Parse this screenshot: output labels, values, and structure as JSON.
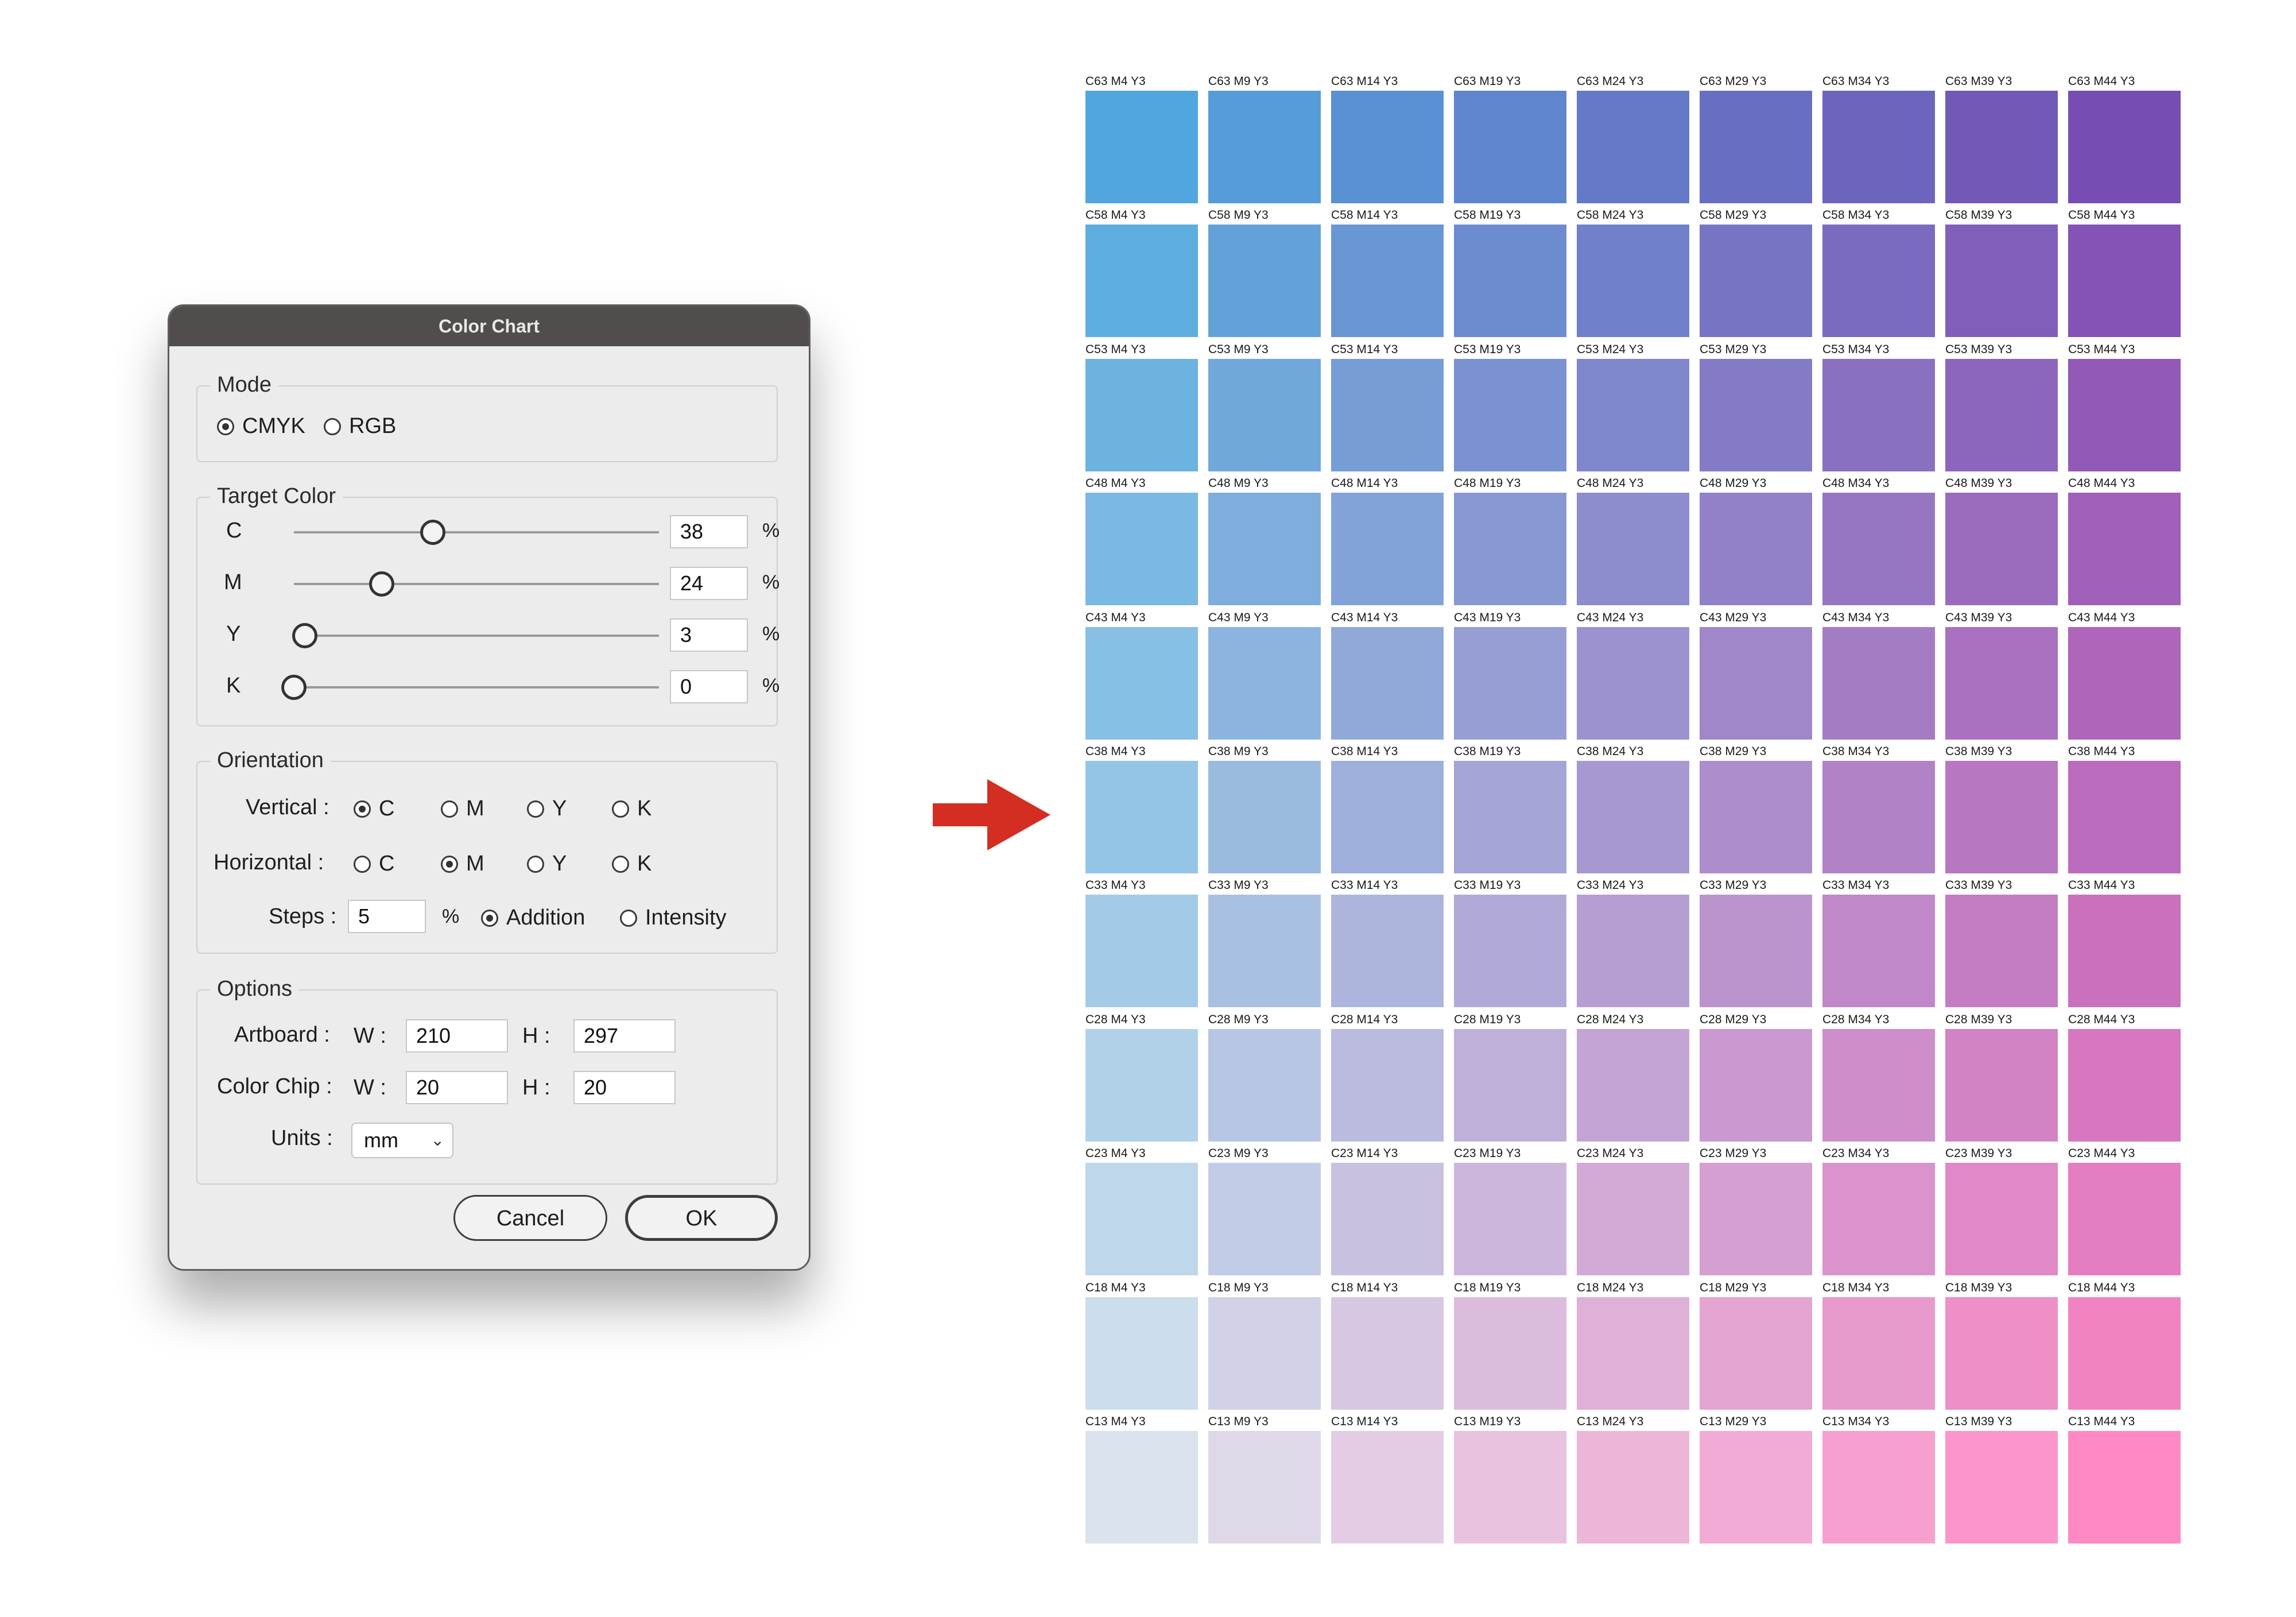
{
  "dialog": {
    "title": "Color Chart",
    "mode": {
      "legend": "Mode",
      "options": [
        "CMYK",
        "RGB"
      ],
      "selected": "CMYK"
    },
    "target": {
      "legend": "Target Color",
      "channels": [
        {
          "label": "C",
          "value": "38",
          "fraction": 0.38
        },
        {
          "label": "M",
          "value": "24",
          "fraction": 0.24
        },
        {
          "label": "Y",
          "value": "3",
          "fraction": 0.03
        },
        {
          "label": "K",
          "value": "0",
          "fraction": 0.0
        }
      ],
      "unit": "%"
    },
    "orientation": {
      "legend": "Orientation",
      "vertical_label": "Vertical :",
      "horizontal_label": "Horizontal :",
      "axis_options": [
        "C",
        "M",
        "Y",
        "K"
      ],
      "vertical_selected": "C",
      "horizontal_selected": "M",
      "steps_label": "Steps :",
      "steps_value": "5",
      "steps_unit": "%",
      "step_modes": [
        "Addition",
        "Intensity"
      ],
      "step_mode_selected": "Addition"
    },
    "options": {
      "legend": "Options",
      "artboard_label": "Artboard :",
      "chip_label": "Color Chip :",
      "w_label": "W :",
      "h_label": "H :",
      "artboard_w": "210",
      "artboard_h": "297",
      "chip_w": "20",
      "chip_h": "20",
      "units_label": "Units :",
      "units_value": "mm"
    },
    "cancel_label": "Cancel",
    "ok_label": "OK"
  },
  "colors": {
    "arrow": "#d42e22",
    "titlebar": "#514d4c"
  },
  "chart_data": {
    "type": "table",
    "rows_c": [
      63,
      58,
      53,
      48,
      43,
      38,
      33,
      28,
      23,
      18,
      13
    ],
    "cols_m": [
      4,
      9,
      14,
      19,
      24,
      29,
      34,
      39,
      44
    ],
    "y": 3,
    "k": 0,
    "label_format": "C{c} M{m} Y{y}"
  }
}
